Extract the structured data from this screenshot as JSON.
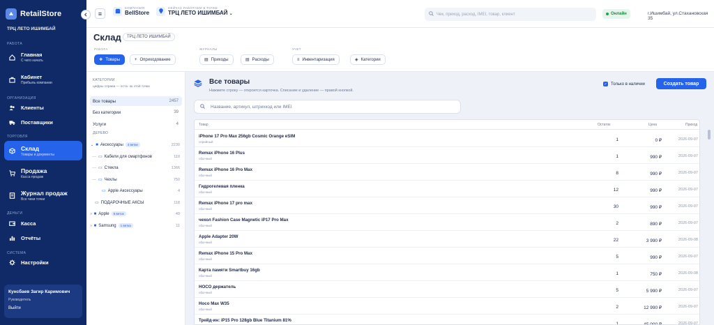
{
  "sidebar": {
    "brand": "RetailStore",
    "store": "ТРЦ ЛЕТО ИШИМБАЙ",
    "sections": {
      "work": "РАБОТА",
      "org": "ОРГАНИЗАЦИЯ",
      "trade": "ТОРГОВЛЯ",
      "money": "ДЕНЬГИ",
      "system": "СИСТЕМА"
    },
    "items": [
      {
        "label": "Главная",
        "sub": "С чего начать"
      },
      {
        "label": "Кабинет",
        "sub": "Прибыль компании"
      },
      {
        "label": "Клиенты",
        "sub": ""
      },
      {
        "label": "Поставщики",
        "sub": ""
      },
      {
        "label": "Склад",
        "sub": "Товары и документы"
      },
      {
        "label": "Продажа",
        "sub": "Касса продаж"
      },
      {
        "label": "Журнал продаж",
        "sub": "Все чеки точки"
      },
      {
        "label": "Касса",
        "sub": ""
      },
      {
        "label": "Отчёты",
        "sub": ""
      },
      {
        "label": "Настройки",
        "sub": ""
      }
    ],
    "user": {
      "name": "Кунсбаев Загир Каримович",
      "role": "Руководитель",
      "logout": "Выйти"
    }
  },
  "topbar": {
    "company_label": "КОМПАНИЯ",
    "company": "BellStore",
    "point_label": "СЕЙЧАС РАБОТАЕМ В ТОЧКЕ",
    "point": "ТРЦ ЛЕТО ИШИМБАЙ",
    "search_placeholder": "Чек, приход, расход, IMEI, товар, клиент",
    "status": "Онлайн",
    "address": "г.Ишимбай, ул.Стахановская 35"
  },
  "page": {
    "title": "Склад",
    "chip": "ТРЦ ЛЕТО ИШИМБАЙ",
    "groups": {
      "work": "РАБОТА",
      "journals": "ЖУРНАЛЫ",
      "account": "УЧЕТ"
    },
    "buttons": {
      "goods": "Товары",
      "writeoff": "Оприходование",
      "incoming": "Приходы",
      "outgoing": "Расходы",
      "inventory": "Инвентаризация",
      "categories": "Категории"
    }
  },
  "cats": {
    "title": "КАТЕГОРИИ",
    "hint": "цифры справа — оста- ок этой точки",
    "rows": [
      {
        "name": "Все товары",
        "count": "2457"
      },
      {
        "name": "Без категории",
        "count": "39"
      },
      {
        "name": "Услуги",
        "count": "4"
      }
    ],
    "tree_title": "ДЕРЕВО",
    "tree": [
      {
        "name": "Аксессуары",
        "tag": "4 ветки",
        "count": "2230"
      },
      {
        "name": "Кабели для смартфонов",
        "count": "119"
      },
      {
        "name": "Стекла",
        "count": "1366"
      },
      {
        "name": "Чехлы",
        "count": "750"
      },
      {
        "name": "Apple Аксессуары",
        "count": "4"
      },
      {
        "name": "ПОДАРОЧНЫЕ АКСЫ",
        "count": "118"
      },
      {
        "name": "Apple",
        "tag": "5 веток",
        "count": "49"
      },
      {
        "name": "Samsung",
        "tag": "1 ветка",
        "count": "11"
      }
    ]
  },
  "main": {
    "title": "Все товары",
    "subtitle": "Нажмите строку — откроется карточка. Списание и удаление — правой кнопкой.",
    "only_stock": "Только в наличии",
    "create": "Создать товар",
    "search_placeholder": "Название, артикул, штрихкод или IMEI",
    "columns": {
      "name": "Товар",
      "qty": "Остаток",
      "price": "Цена",
      "date": "Приход"
    },
    "rows": [
      {
        "name": "iPhone 17 Pro Max 256gb Cosmic Orange eSIM",
        "sub": "серийный",
        "qty": "1",
        "price": "0 ₽",
        "date": "2026-09-07"
      },
      {
        "name": "Remax iPhone 16 Plus",
        "sub": "обычный",
        "qty": "1",
        "price": "990 ₽",
        "date": "2026-09-07"
      },
      {
        "name": "Remax iPhone 16 Pro Max",
        "sub": "обычный",
        "qty": "8",
        "price": "990 ₽",
        "date": "2026-09-07"
      },
      {
        "name": "Гидрогелевая пленка",
        "sub": "обычный",
        "qty": "12",
        "price": "990 ₽",
        "date": "2026-09-07"
      },
      {
        "name": "Remax iPhone 17 pro max",
        "sub": "обычный",
        "qty": "30",
        "price": "990 ₽",
        "date": "2026-09-07"
      },
      {
        "name": "чехол Fashion Case Magnetic iP17 Pro Max",
        "sub": "обычный",
        "qty": "2",
        "price": "890 ₽",
        "date": "2026-09-07"
      },
      {
        "name": "Apple Adapter 20W",
        "sub": "обычный",
        "qty": "22",
        "price": "3 990 ₽",
        "date": "2026-09-08"
      },
      {
        "name": "Remax iPhone 15 Pro Max",
        "sub": "обычный",
        "qty": "5",
        "price": "990 ₽",
        "date": "2026-09-07"
      },
      {
        "name": "Карта памяти Smartbuy 16gb",
        "sub": "обычный",
        "qty": "1",
        "price": "750 ₽",
        "date": "2026-09-08"
      },
      {
        "name": "НОСО держатель",
        "sub": "обычный",
        "qty": "5",
        "price": "5 990 ₽",
        "date": "2026-09-07"
      },
      {
        "name": "Hoco Max W35",
        "sub": "обычный",
        "qty": "2",
        "price": "12 990 ₽",
        "date": "2026-09-07"
      },
      {
        "name": "Трейд-ин: iP15 Pro 128gb Blue Titanium 81%",
        "sub": "",
        "qty": "1",
        "price": "45 000 ₽",
        "date": "2026-09-07"
      }
    ]
  }
}
